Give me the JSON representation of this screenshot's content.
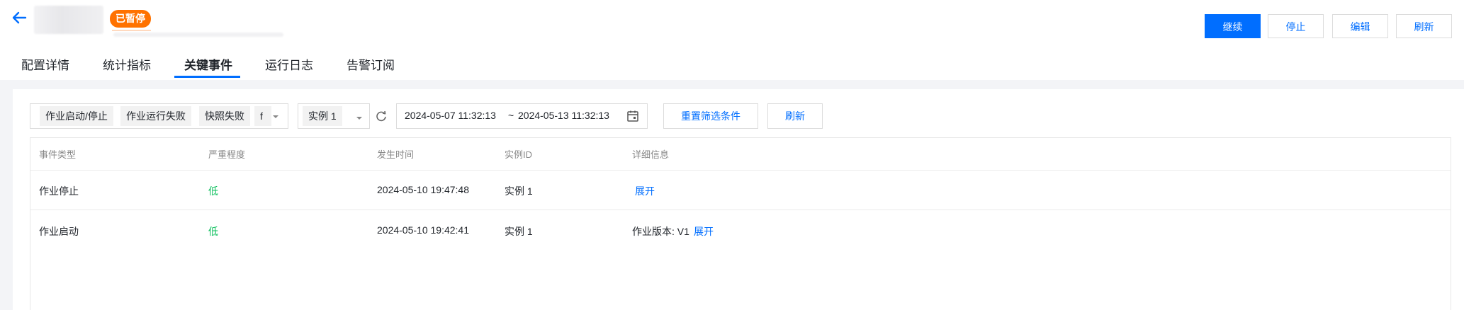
{
  "header": {
    "status_badge": "已暂停",
    "buttons": {
      "continue": "继续",
      "stop": "停止",
      "edit": "编辑",
      "refresh": "刷新"
    }
  },
  "tabs": [
    {
      "label": "配置详情"
    },
    {
      "label": "统计指标"
    },
    {
      "label": "关键事件",
      "active": true
    },
    {
      "label": "运行日志"
    },
    {
      "label": "告警订阅"
    }
  ],
  "filters": {
    "event_types": [
      "作业启动/停止",
      "作业运行失败",
      "快照失败",
      "f"
    ],
    "instance": "实例 1",
    "date_start": "2024-05-07 11:32:13",
    "date_sep": "~",
    "date_end": "2024-05-13 11:32:13",
    "reset_label": "重置筛选条件",
    "refresh_label": "刷新"
  },
  "table": {
    "columns": [
      "事件类型",
      "严重程度",
      "发生时间",
      "实例ID",
      "详细信息"
    ],
    "rows": [
      {
        "type": "作业停止",
        "severity": "低",
        "time": "2024-05-10 19:47:48",
        "instance": "实例 1",
        "detail": "",
        "expand": "展开"
      },
      {
        "type": "作业启动",
        "severity": "低",
        "time": "2024-05-10 19:42:41",
        "instance": "实例 1",
        "detail": "作业版本: V1",
        "expand": "展开"
      }
    ]
  },
  "colors": {
    "primary": "#006eff",
    "status_orange": "#ff7200",
    "severity_low": "#0abf5b"
  }
}
